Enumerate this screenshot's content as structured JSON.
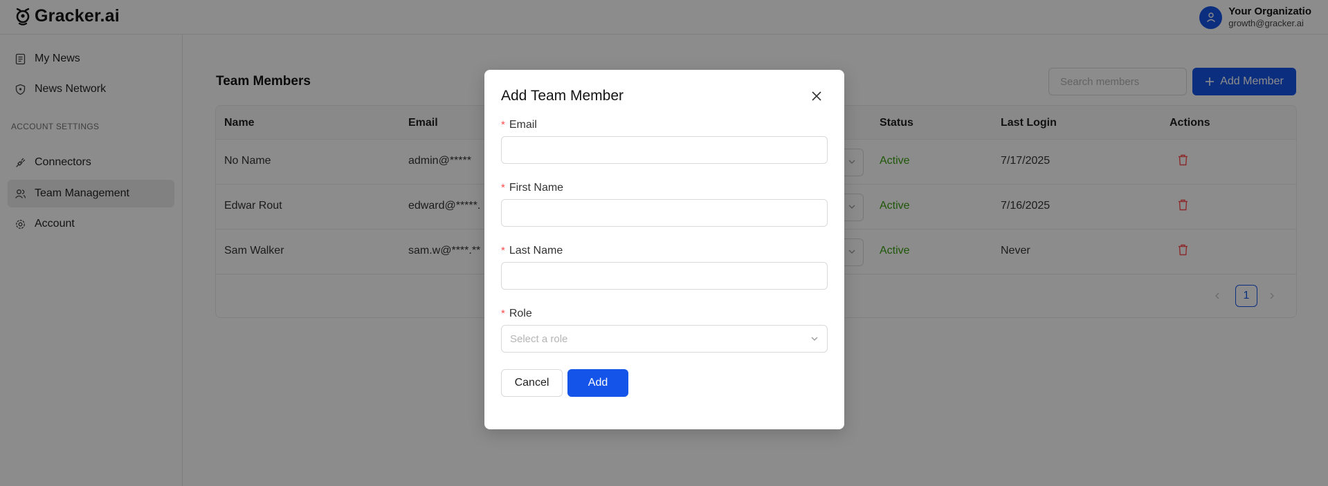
{
  "header": {
    "logo_text": "Gracker.ai",
    "user_name": "Your Organizatio",
    "user_email": "growth@gracker.ai"
  },
  "sidebar": {
    "items": [
      {
        "label": "My News",
        "icon": "news-icon"
      },
      {
        "label": "News Network",
        "icon": "shield-icon"
      }
    ],
    "section_label": "ACCOUNT SETTINGS",
    "settings_items": [
      {
        "label": "Connectors",
        "icon": "connector-icon"
      },
      {
        "label": "Team Management",
        "icon": "team-icon",
        "active": true
      },
      {
        "label": "Account",
        "icon": "gear-icon"
      }
    ]
  },
  "main": {
    "title": "Team Members",
    "search_placeholder": "Search members",
    "add_member_label": "Add Member",
    "columns": [
      "Name",
      "Email",
      "Status",
      "Last Login",
      "Actions"
    ],
    "rows": [
      {
        "name": "No Name",
        "email": "admin@*****",
        "status": "Active",
        "last_login": "7/17/2025"
      },
      {
        "name": "Edwar Rout",
        "email": "edward@*****.",
        "status": "Active",
        "last_login": "7/16/2025"
      },
      {
        "name": "Sam Walker",
        "email": "sam.w@****.**",
        "status": "Active",
        "last_login": "Never"
      }
    ],
    "pagination": {
      "current_page": "1"
    }
  },
  "modal": {
    "title": "Add Team Member",
    "fields": {
      "email_label": "Email",
      "first_name_label": "First Name",
      "last_name_label": "Last Name",
      "role_label": "Role",
      "role_placeholder": "Select a role"
    },
    "required_mark": "*",
    "cancel_label": "Cancel",
    "add_label": "Add"
  },
  "colors": {
    "primary": "#1554e8",
    "status_active": "#389e0d",
    "danger": "#ff4d4f"
  }
}
